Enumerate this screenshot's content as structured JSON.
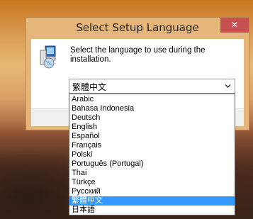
{
  "window": {
    "title": "Select Setup Language",
    "close_glyph": "✕"
  },
  "prompt": {
    "text": "Select the language to use during the installation."
  },
  "icons": {
    "setup": "setup-computer-cd-icon",
    "dropdown": "chevron-down-icon",
    "close": "close-icon"
  },
  "language_select": {
    "value": "繁體中文",
    "options": [
      {
        "label": "Arabic",
        "selected": false
      },
      {
        "label": "Bahasa Indonesia",
        "selected": false
      },
      {
        "label": "Deutsch",
        "selected": false
      },
      {
        "label": "English",
        "selected": false
      },
      {
        "label": "Español",
        "selected": false
      },
      {
        "label": "Français",
        "selected": false
      },
      {
        "label": "Polski",
        "selected": false
      },
      {
        "label": "Português (Portugal)",
        "selected": false
      },
      {
        "label": "Thai",
        "selected": false
      },
      {
        "label": "Türkçe",
        "selected": false
      },
      {
        "label": "Русский",
        "selected": false
      },
      {
        "label": "繁體中文",
        "selected": true
      },
      {
        "label": "日本語",
        "selected": false
      }
    ]
  },
  "colors": {
    "close_button": "#c75050",
    "selection": "#3399ff",
    "window_frame": "#e5b57a"
  }
}
